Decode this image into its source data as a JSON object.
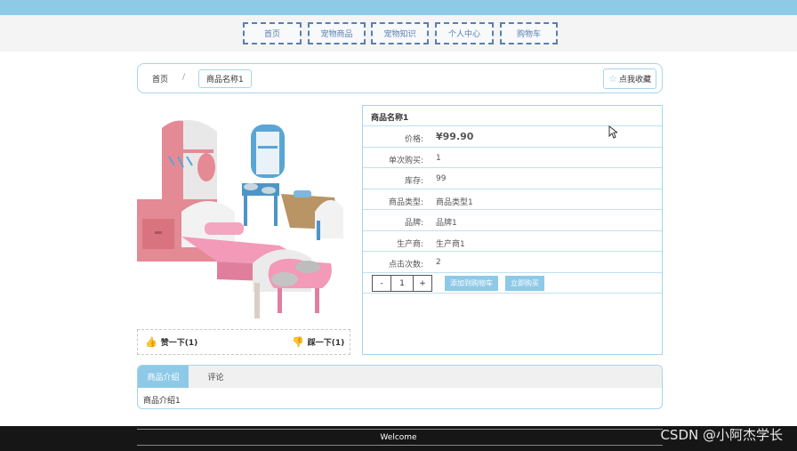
{
  "nav": {
    "items": [
      {
        "label": "首页"
      },
      {
        "label": "宠物商品"
      },
      {
        "label": "宠物知识"
      },
      {
        "label": "个人中心"
      },
      {
        "label": "购物车"
      }
    ]
  },
  "breadcrumb": {
    "home": "首页",
    "separator": "/",
    "current": "商品名称1",
    "favorite_label": "点我收藏",
    "favorite_icon": "star-icon"
  },
  "vote": {
    "like_label": "赞一下(1)",
    "dislike_label": "踩一下(1)",
    "like_icon": "thumbs-up-icon",
    "dislike_icon": "thumbs-down-icon"
  },
  "product": {
    "name": "商品名称1",
    "rows": [
      {
        "label": "价格:",
        "value": "¥99.90"
      },
      {
        "label": "单次购买:",
        "value": "1"
      },
      {
        "label": "库存:",
        "value": "99"
      },
      {
        "label": "商品类型:",
        "value": "商品类型1"
      },
      {
        "label": "品牌:",
        "value": "品牌1"
      },
      {
        "label": "生产商:",
        "value": "生产商1"
      },
      {
        "label": "点击次数:",
        "value": "2"
      }
    ],
    "quantity": "1",
    "minus": "-",
    "plus": "+",
    "add_to_cart": "添加到购物车",
    "buy_now": "立即购买"
  },
  "tabs": {
    "items": [
      {
        "label": "商品介绍"
      },
      {
        "label": "评论"
      }
    ],
    "content": "商品介绍1"
  },
  "footer": {
    "text": "Welcome"
  },
  "watermark": "CSDN @小阿杰学长",
  "colors": {
    "accent": "#8ec9e7",
    "nav_border": "#5a7fb0",
    "footer": "#161616"
  }
}
